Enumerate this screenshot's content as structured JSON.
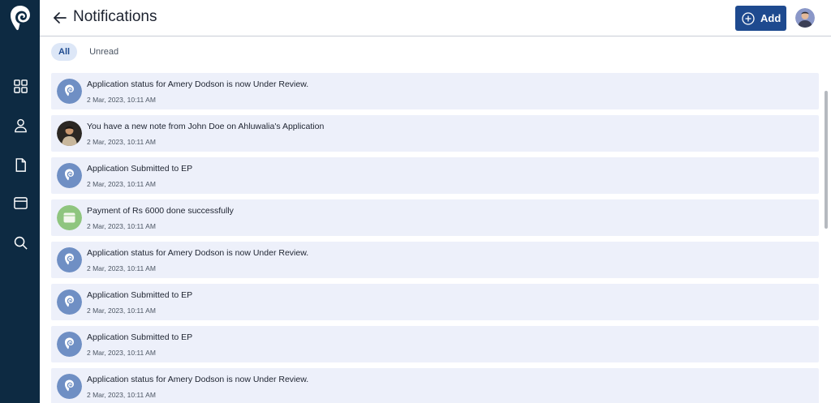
{
  "header": {
    "title": "Notifications",
    "add_label": "Add"
  },
  "tabs": [
    {
      "label": "All",
      "active": true
    },
    {
      "label": "Unread",
      "active": false
    }
  ],
  "notifications": [
    {
      "message": "Application status for Amery Dodson is now Under Review.",
      "time": "2 Mar, 2023, 10:11 AM",
      "icon": "brand-logo-icon"
    },
    {
      "message": "You have a new note from John Doe on Ahluwalia's Application",
      "time": "2 Mar, 2023, 10:11 AM",
      "icon": "user-photo-icon"
    },
    {
      "message": "Application Submitted to EP",
      "time": "2 Mar, 2023, 10:11 AM",
      "icon": "brand-logo-icon"
    },
    {
      "message": "Payment of Rs 6000 done successfully",
      "time": "2 Mar, 2023, 10:11 AM",
      "icon": "wallet-icon"
    },
    {
      "message": "Application status for Amery Dodson is now Under Review.",
      "time": "2 Mar, 2023, 10:11 AM",
      "icon": "brand-logo-icon"
    },
    {
      "message": "Application Submitted to EP",
      "time": "2 Mar, 2023, 10:11 AM",
      "icon": "brand-logo-icon"
    },
    {
      "message": "Application Submitted to EP",
      "time": "2 Mar, 2023, 10:11 AM",
      "icon": "brand-logo-icon"
    },
    {
      "message": "Application status for Amery Dodson is now Under Review.",
      "time": "2 Mar, 2023, 10:11 AM",
      "icon": "brand-logo-icon"
    }
  ],
  "colors": {
    "sidebar": "#0d2a42",
    "accent": "#1e4a8f",
    "item_background": "#edf0fa",
    "logo_circle": "#6f8fc4",
    "wallet_circle": "#8fc57f"
  }
}
